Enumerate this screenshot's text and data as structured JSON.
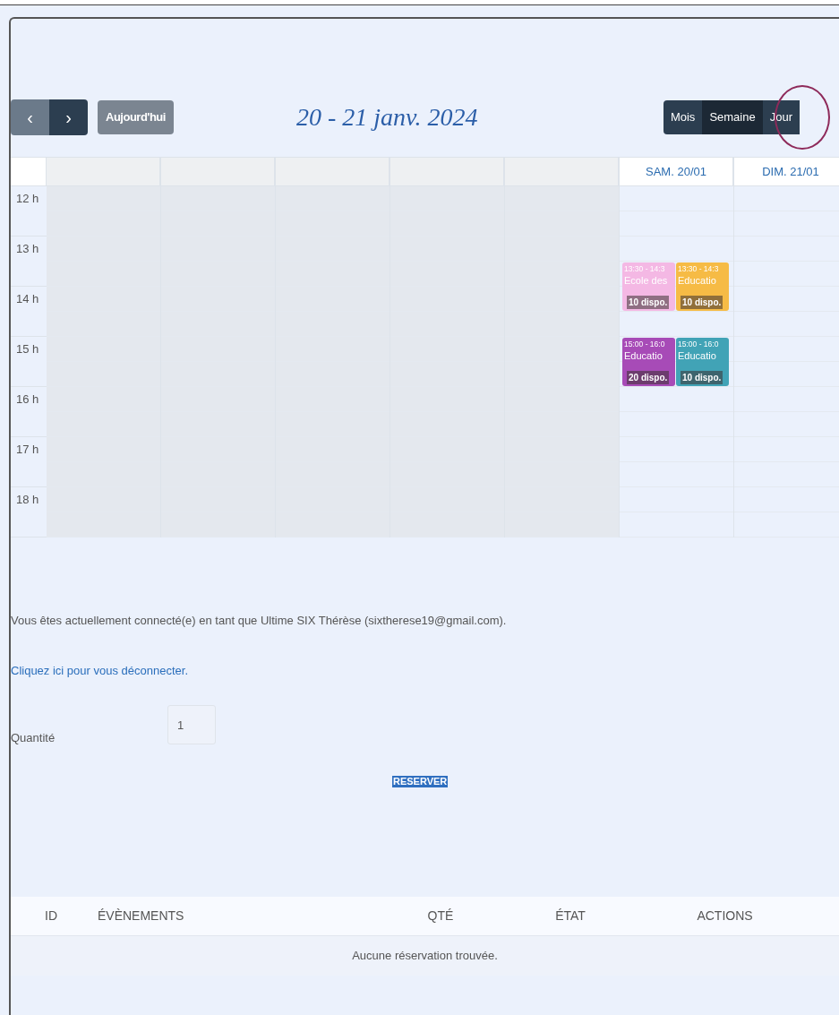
{
  "toolbar": {
    "prev": "‹",
    "next": "›",
    "today": "Aujourd'hui",
    "title": "20 - 21 janv. 2024",
    "views": [
      {
        "label": "Mois",
        "selected": false
      },
      {
        "label": "Semaine",
        "selected": true
      },
      {
        "label": "Jour",
        "selected": false,
        "circled": true
      }
    ]
  },
  "calendar": {
    "hours": [
      "12 h",
      "13 h",
      "14 h",
      "15 h",
      "16 h",
      "17 h",
      "18 h"
    ],
    "columns": [
      {
        "kind": "past"
      },
      {
        "kind": "past"
      },
      {
        "kind": "past"
      },
      {
        "kind": "past"
      },
      {
        "kind": "past"
      },
      {
        "kind": "day",
        "label": "SAM. 20/01",
        "events": [
          {
            "time": "13:30 - 14:3",
            "title": "Ecole des",
            "badge": "10 dispo.",
            "color": "#f4b8e4"
          },
          {
            "time": "13:30 - 14:3",
            "title": "Educatio",
            "badge": "10 dispo.",
            "color": "#f6bb45"
          },
          {
            "time": "15:00 - 16:0",
            "title": "Educatio",
            "badge": "20 dispo.",
            "color": "#a74bb7"
          },
          {
            "time": "15:00 - 16:0",
            "title": "Educatio",
            "badge": "10 dispo.",
            "color": "#41a3b6"
          }
        ]
      },
      {
        "kind": "day",
        "label": "DIM. 21/01"
      }
    ]
  },
  "session": {
    "message": "Vous êtes actuellement connecté(e) en tant que Ultime SIX Thérèse (sixtherese19@gmail.com).",
    "logout_link": "Cliquez ici pour vous déconnecter."
  },
  "form": {
    "quantity_label": "Quantité",
    "quantity_value": "1",
    "submit": "RESERVER"
  },
  "table": {
    "columns": [
      "ID",
      "ÉVÈNEMENTS",
      "QTÉ",
      "ÉTAT",
      "ACTIONS"
    ],
    "empty_message": "Aucune réservation trouvée."
  }
}
